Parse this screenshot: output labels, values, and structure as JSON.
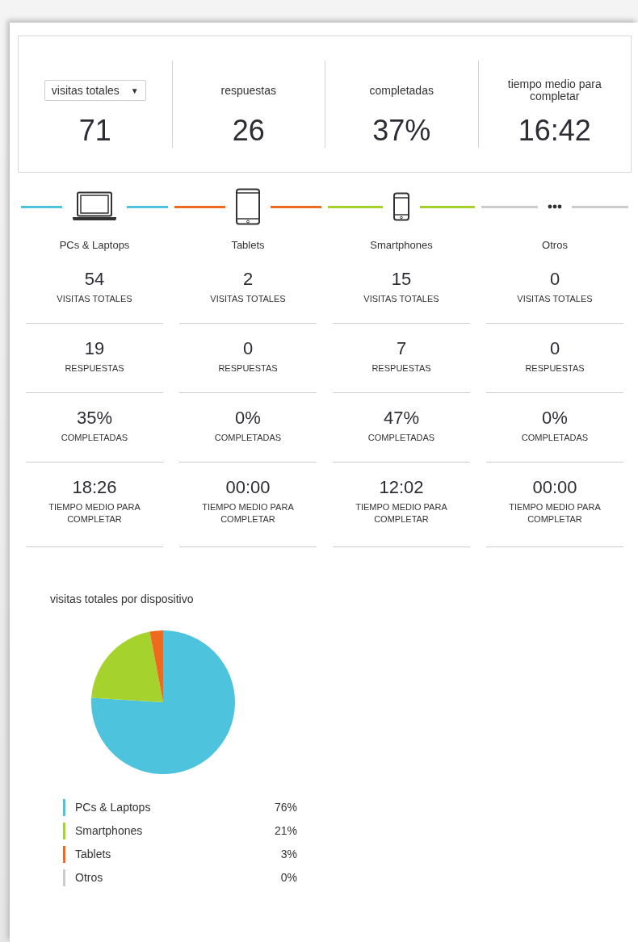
{
  "summary": {
    "dropdown": {
      "value": "visitas totales",
      "caret": "▼"
    },
    "metrics": [
      {
        "value": "71"
      },
      {
        "label": "respuestas",
        "value": "26"
      },
      {
        "label": "completadas",
        "value": "37%"
      },
      {
        "label": "tiempo medio para completar",
        "value": "16:42"
      }
    ]
  },
  "devices": [
    {
      "kind": "laptop",
      "name": "PCs & Laptops",
      "color": "#4ec3de",
      "stats": [
        {
          "value": "54",
          "label": "VISITAS TOTALES"
        },
        {
          "value": "19",
          "label": "RESPUESTAS"
        },
        {
          "value": "35%",
          "label": "COMPLETADAS"
        },
        {
          "value": "18:26",
          "label": "TIEMPO MEDIO PARA COMPLETAR"
        }
      ]
    },
    {
      "kind": "tablet",
      "name": "Tablets",
      "color": "#ee6a1e",
      "stats": [
        {
          "value": "2",
          "label": "VISITAS TOTALES"
        },
        {
          "value": "0",
          "label": "RESPUESTAS"
        },
        {
          "value": "0%",
          "label": "COMPLETADAS"
        },
        {
          "value": "00:00",
          "label": "TIEMPO MEDIO PARA COMPLETAR"
        }
      ]
    },
    {
      "kind": "phone",
      "name": "Smartphones",
      "color": "#a5d22c",
      "stats": [
        {
          "value": "15",
          "label": "VISITAS TOTALES"
        },
        {
          "value": "7",
          "label": "RESPUESTAS"
        },
        {
          "value": "47%",
          "label": "COMPLETADAS"
        },
        {
          "value": "12:02",
          "label": "TIEMPO MEDIO PARA COMPLETAR"
        }
      ]
    },
    {
      "kind": "other",
      "name": "Otros",
      "color": "#cccccc",
      "stats": [
        {
          "value": "0",
          "label": "VISITAS TOTALES"
        },
        {
          "value": "0",
          "label": "RESPUESTAS"
        },
        {
          "value": "0%",
          "label": "COMPLETADAS"
        },
        {
          "value": "00:00",
          "label": "TIEMPO MEDIO PARA COMPLETAR"
        }
      ]
    }
  ],
  "chart": {
    "chart_data": {
      "type": "pie",
      "title": "visitas totales por dispositivo",
      "categories": [
        "PCs & Laptops",
        "Smartphones",
        "Tablets",
        "Otros"
      ],
      "series": [
        {
          "values": [
            76,
            21,
            3,
            0
          ]
        }
      ],
      "legend": "bottom",
      "colors": [
        "#4ec3de",
        "#a5d22c",
        "#ee6a1e",
        "#cccccc"
      ],
      "value_labels": [
        "76%",
        "21%",
        "3%",
        "0%"
      ]
    }
  }
}
